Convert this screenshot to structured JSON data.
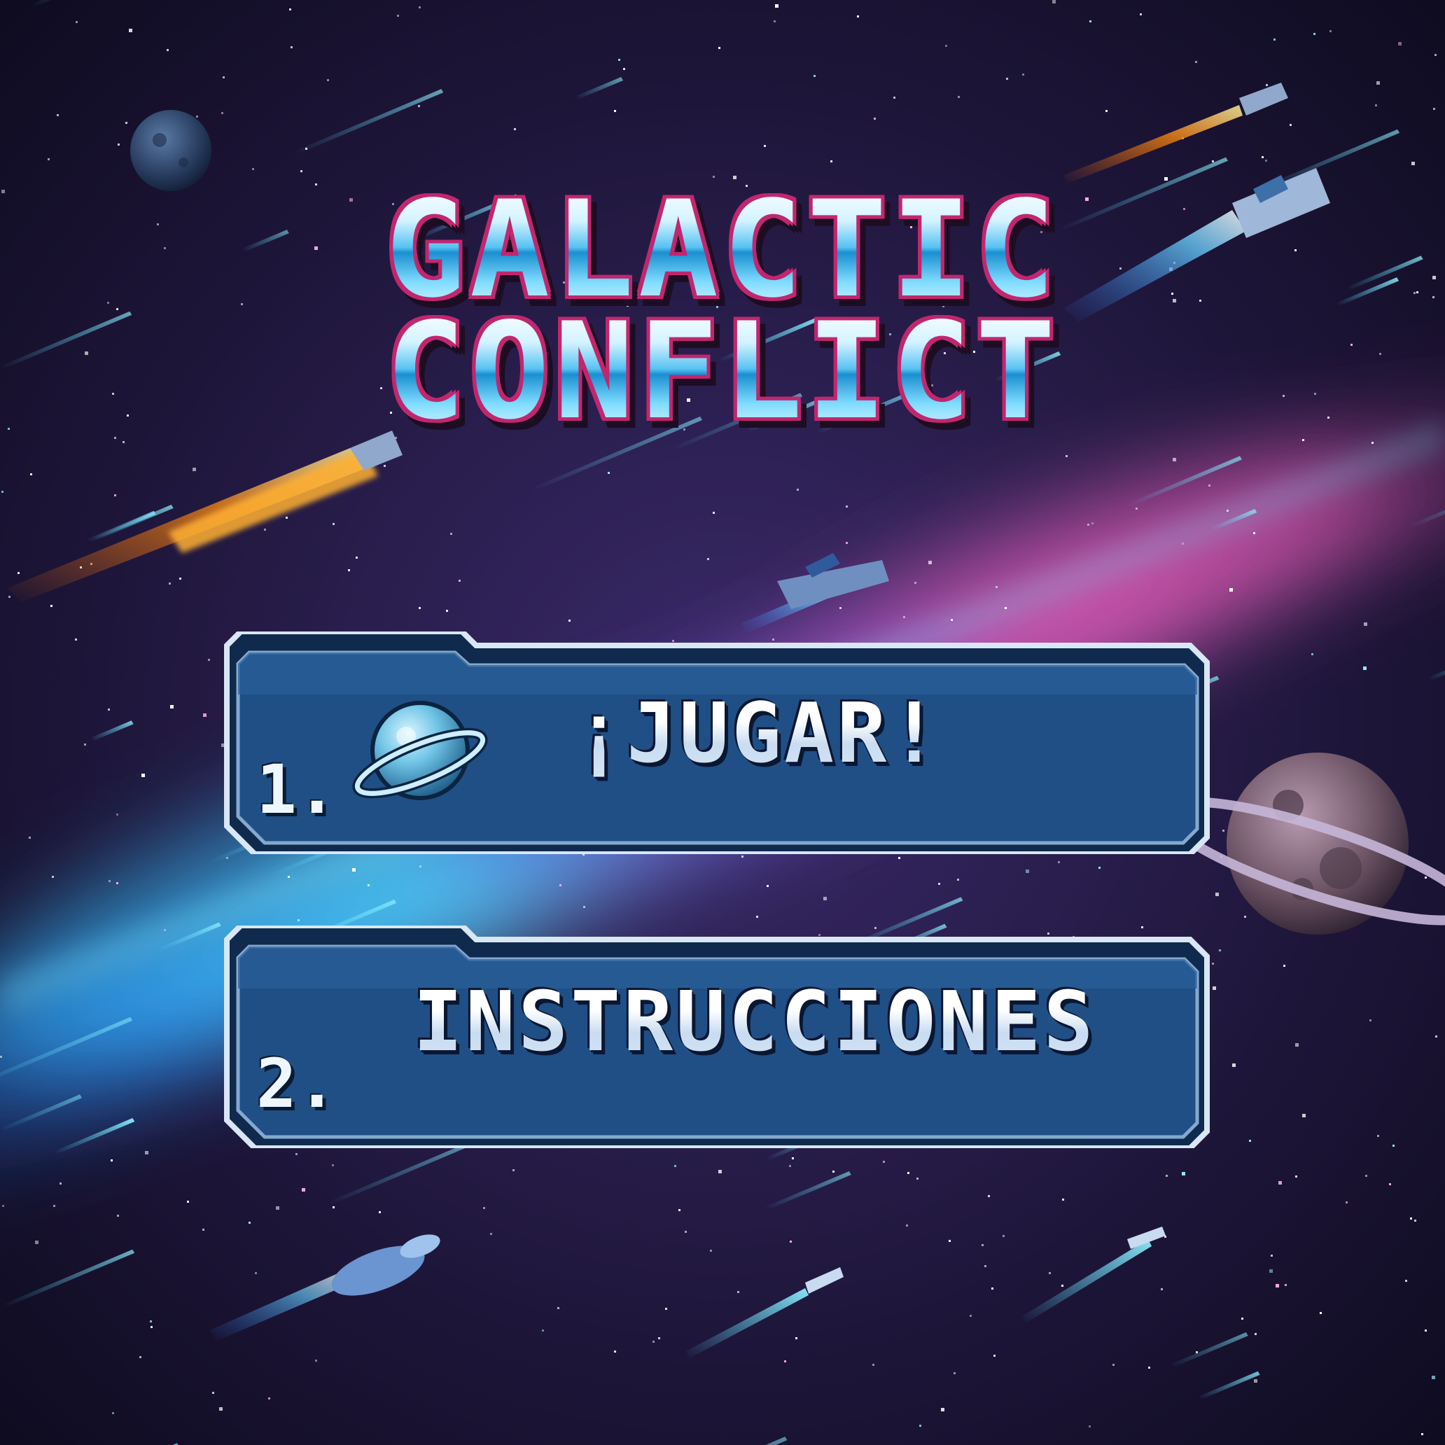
{
  "title": {
    "line1": "GALACTIC",
    "line2": "CONFLICT"
  },
  "menu": {
    "items": [
      {
        "number": "1.",
        "label": "¡JUGAR!",
        "icon": "ringed-planet-icon"
      },
      {
        "number": "2.",
        "label": "INSTRUCCIONES"
      }
    ]
  },
  "colors": {
    "title_fill": "#8fdcff",
    "title_outline": "#c2266f",
    "button_fill": "#1f4f85",
    "button_border": "#a9c8e4",
    "button_text": "#eef7ff"
  }
}
